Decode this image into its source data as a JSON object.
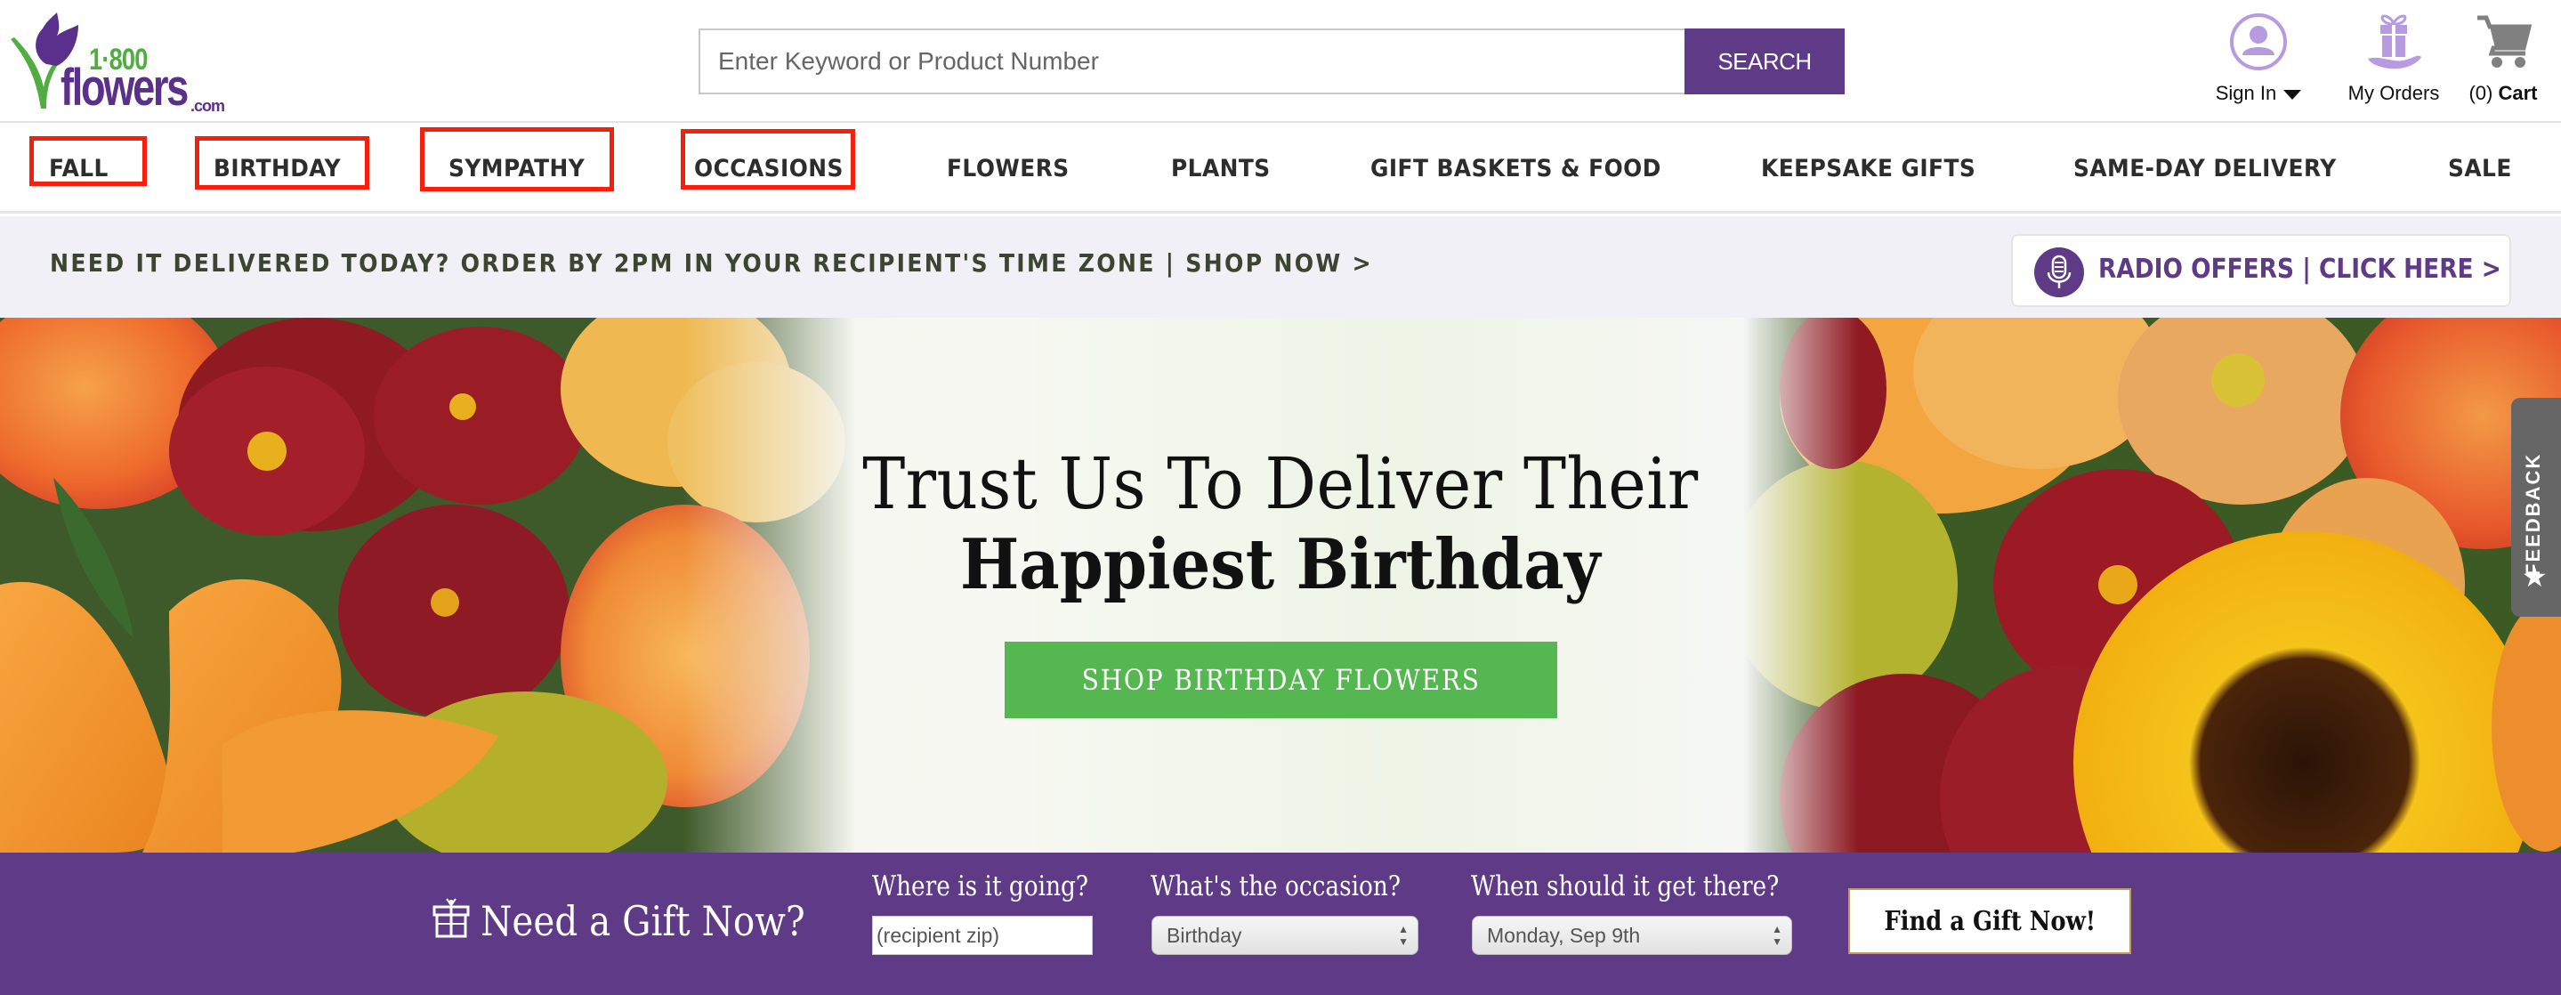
{
  "header": {
    "logo": {
      "number": "1·800",
      "name": "flowers",
      "tld": ".com"
    },
    "search": {
      "placeholder": "Enter Keyword or Product Number",
      "value": "",
      "button_label": "SEARCH"
    },
    "utility": {
      "sign_in": {
        "label": "Sign In",
        "icon": "user-circle-icon"
      },
      "my_orders": {
        "label": "My Orders",
        "icon": "gift-in-hand-icon"
      },
      "cart": {
        "count": "(0)",
        "label": "Cart",
        "icon": "shopping-cart-icon"
      }
    }
  },
  "nav": {
    "items": [
      {
        "label": "FALL",
        "highlighted": true
      },
      {
        "label": "BIRTHDAY",
        "highlighted": true
      },
      {
        "label": "SYMPATHY",
        "highlighted": true
      },
      {
        "label": "OCCASIONS",
        "highlighted": true
      },
      {
        "label": "FLOWERS",
        "highlighted": false
      },
      {
        "label": "PLANTS",
        "highlighted": false
      },
      {
        "label": "GIFT BASKETS & FOOD",
        "highlighted": false
      },
      {
        "label": "KEEPSAKE GIFTS",
        "highlighted": false
      },
      {
        "label": "SAME-DAY DELIVERY",
        "highlighted": false
      },
      {
        "label": "SALE",
        "highlighted": false
      }
    ],
    "highlight_color": "#f2200d"
  },
  "banner": {
    "promo_text": "NEED IT DELIVERED TODAY? ORDER BY 2PM IN YOUR RECIPIENT'S TIME ZONE | SHOP NOW >",
    "radio_offer": {
      "label": "RADIO OFFERS | CLICK HERE >",
      "icon": "microphone-icon"
    }
  },
  "hero": {
    "title_line1": "Trust Us To Deliver Their",
    "title_line2": "Happiest Birthday",
    "cta_label": "SHOP BIRTHDAY FLOWERS",
    "cta_color": "#55b750"
  },
  "feedback_tab": {
    "label": "FEEDBACK",
    "icon": "star-icon"
  },
  "gift_finder": {
    "title": "Need a Gift Now?",
    "zip": {
      "label": "Where is it going?",
      "placeholder": "(recipient zip)",
      "value": ""
    },
    "occasion": {
      "label": "What's the occasion?",
      "selected": "Birthday"
    },
    "date": {
      "label": "When should it get there?",
      "selected": "Monday, Sep 9th"
    },
    "submit_label": "Find a Gift Now!"
  },
  "colors": {
    "brand_purple": "#5e3a87",
    "brand_green": "#4fae3f",
    "banner_bg": "#f2f0f7"
  }
}
